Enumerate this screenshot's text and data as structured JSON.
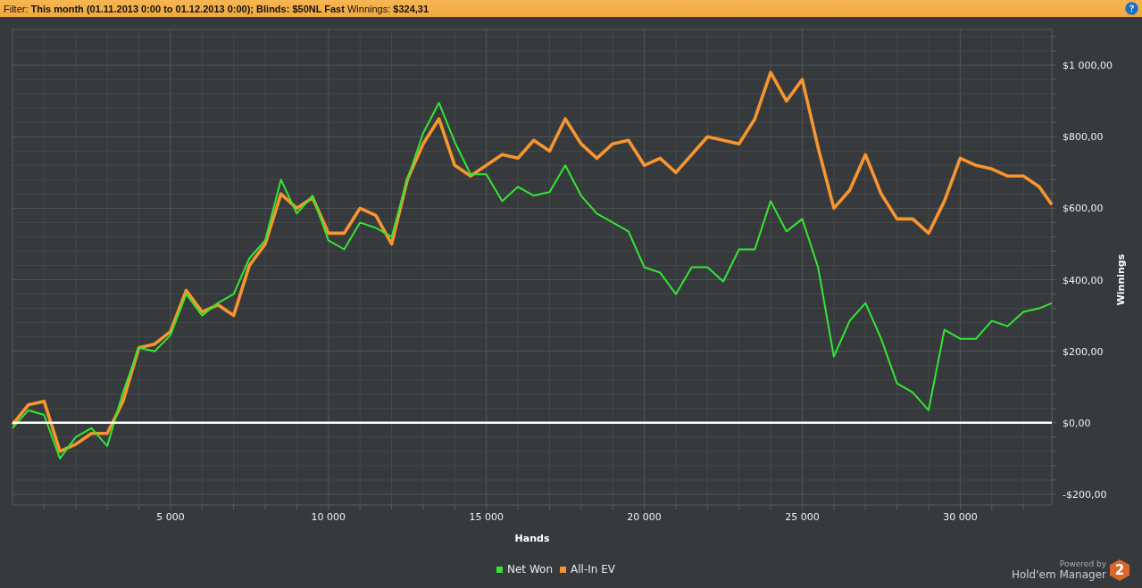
{
  "filter_bar": {
    "text": "Filter: **This month (01.11.2013 0:00 to 01.12.2013 0:00); Blinds: $50NL Fast** Winnings: **$324,31**"
  },
  "chart": {
    "chart_data": {
      "type": "line",
      "xlabel": "Hands",
      "ylabel": "Winnings",
      "x": [
        0,
        500,
        1000,
        1500,
        2000,
        2500,
        3000,
        3500,
        4000,
        4500,
        5000,
        5500,
        6000,
        6500,
        7000,
        7500,
        8000,
        8500,
        9000,
        9500,
        10000,
        10500,
        11000,
        11500,
        12000,
        12500,
        13000,
        13500,
        14000,
        14500,
        15000,
        15500,
        16000,
        16500,
        17000,
        17500,
        18000,
        18500,
        19000,
        19500,
        20000,
        20500,
        21000,
        21500,
        22000,
        22500,
        23000,
        23500,
        24000,
        24500,
        25000,
        25500,
        26000,
        26500,
        27000,
        27500,
        28000,
        28500,
        29000,
        29500,
        30000,
        30500,
        31000,
        31500,
        32000,
        32500,
        32900
      ],
      "series": [
        {
          "name": "Net Won",
          "color": "#33e633",
          "values": [
            -15,
            35,
            22,
            -100,
            -40,
            -15,
            -65,
            85,
            210,
            200,
            245,
            360,
            300,
            335,
            360,
            460,
            510,
            680,
            585,
            635,
            510,
            485,
            560,
            545,
            520,
            680,
            810,
            895,
            785,
            695,
            695,
            620,
            660,
            635,
            645,
            720,
            635,
            585,
            560,
            535,
            435,
            420,
            360,
            435,
            435,
            395,
            485,
            485,
            620,
            535,
            570,
            435,
            185,
            285,
            335,
            235,
            110,
            85,
            35,
            260,
            235,
            235,
            285,
            270,
            310,
            320,
            335
          ]
        },
        {
          "name": "All-In EV",
          "color": "#f7952f",
          "values": [
            -5,
            50,
            60,
            -80,
            -60,
            -30,
            -30,
            60,
            210,
            220,
            255,
            370,
            310,
            330,
            300,
            440,
            500,
            640,
            600,
            630,
            530,
            530,
            600,
            580,
            500,
            680,
            780,
            850,
            720,
            690,
            720,
            750,
            740,
            790,
            760,
            850,
            780,
            740,
            780,
            790,
            720,
            740,
            700,
            750,
            800,
            790,
            780,
            850,
            980,
            900,
            960,
            770,
            600,
            650,
            750,
            640,
            570,
            570,
            530,
            620,
            740,
            720,
            710,
            690,
            690,
            660,
            610
          ]
        }
      ],
      "grid": true,
      "xlim": [
        0,
        32900
      ],
      "ylim": [
        -230,
        1100
      ],
      "xticks": [
        {
          "value": 5000,
          "label": "5 000"
        },
        {
          "value": 10000,
          "label": "10 000"
        },
        {
          "value": 15000,
          "label": "15 000"
        },
        {
          "value": 20000,
          "label": "20 000"
        },
        {
          "value": 25000,
          "label": "25 000"
        },
        {
          "value": 30000,
          "label": "30 000"
        }
      ],
      "yticks": [
        {
          "value": -200,
          "label": "-$200,00"
        },
        {
          "value": 0,
          "label": "$0,00"
        },
        {
          "value": 200,
          "label": "$200,00"
        },
        {
          "value": 400,
          "label": "$400,00"
        },
        {
          "value": 600,
          "label": "$600,00"
        },
        {
          "value": 800,
          "label": "$800,00"
        },
        {
          "value": 1000,
          "label": "$1 000,00"
        }
      ]
    }
  },
  "footer": {
    "powered_by": "Powered by",
    "product": "Hold'em Manager",
    "logo_badge": "2"
  }
}
